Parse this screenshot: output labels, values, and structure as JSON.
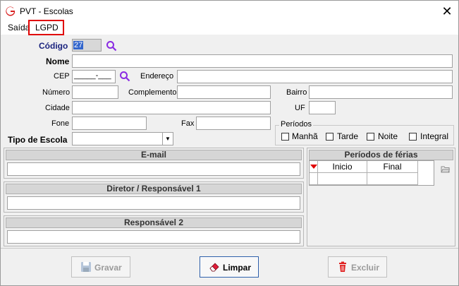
{
  "window": {
    "title": "PVT - Escolas",
    "close_glyph": "✕"
  },
  "menu": {
    "items": [
      "Saída",
      "LGPD"
    ]
  },
  "form": {
    "codigo_label": "Código",
    "codigo_value": "27",
    "nome_label": "Nome",
    "cep_label": "CEP",
    "cep_mask": "_____-___",
    "endereco_label": "Endereço",
    "numero_label": "Número",
    "complemento_label": "Complemento",
    "bairro_label": "Bairro",
    "cidade_label": "Cidade",
    "uf_label": "UF",
    "fone_label": "Fone",
    "fax_label": "Fax",
    "tipo_escola_label": "Tipo de Escola",
    "periodos": {
      "title": "Períodos",
      "options": [
        "Manhã",
        "Tarde",
        "Noite",
        "Integral"
      ]
    }
  },
  "sections": {
    "email": "E-mail",
    "diretor": "Diretor / Responsável 1",
    "responsavel2": "Responsável 2"
  },
  "ferias": {
    "title": "Períodos de férias",
    "columns": [
      "Inicio",
      "Final"
    ]
  },
  "buttons": {
    "gravar": "Gravar",
    "limpar": "Limpar",
    "excluir": "Excluir"
  },
  "colors": {
    "accent_search": "#8a2be2",
    "selection": "#3366cc",
    "lgpd_highlight": "#e00000",
    "excluir_icon": "#e02020"
  }
}
